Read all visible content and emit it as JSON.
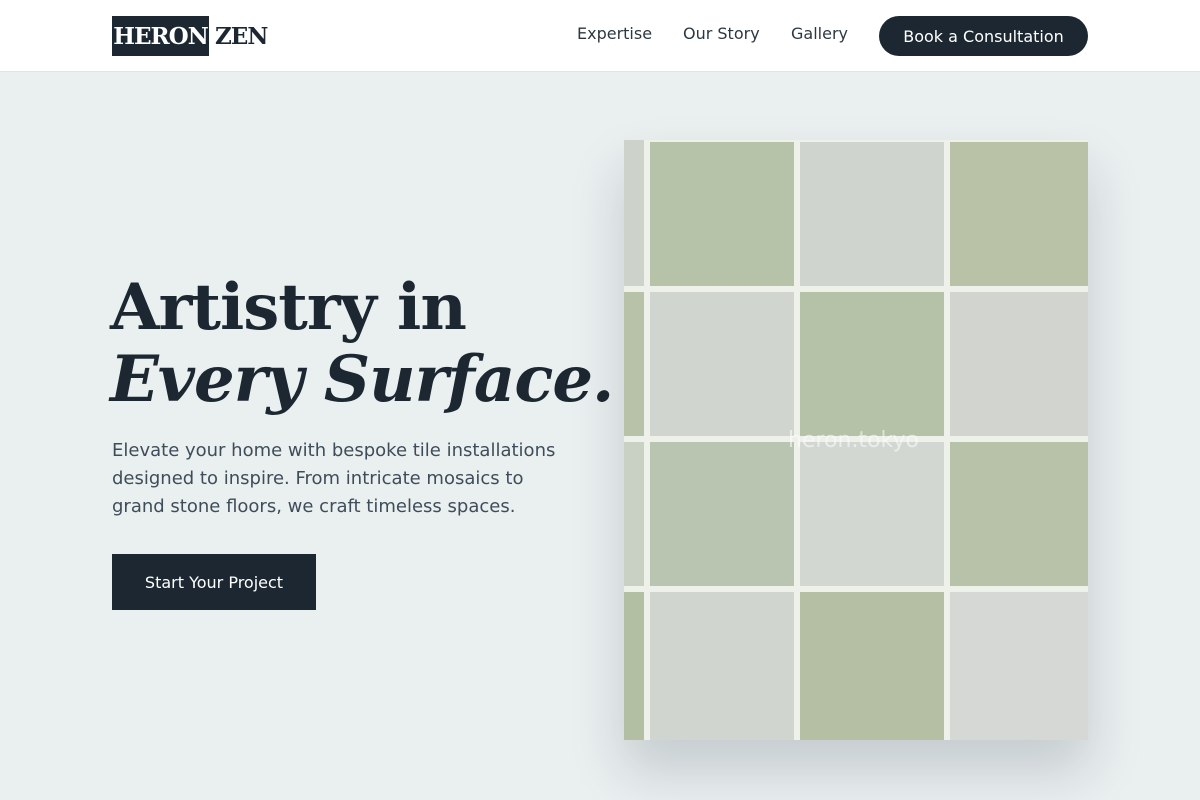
{
  "header": {
    "logo_primary": "HERON",
    "logo_secondary": "ZEN",
    "nav": [
      "Expertise",
      "Our Story",
      "Gallery"
    ],
    "cta_label": "Book a Consultation"
  },
  "hero": {
    "title_line1": "Artistry in",
    "title_line2": "Every Surface.",
    "description": "Elevate your home with bespoke tile installations designed to inspire. From intricate mosaics to grand stone floors, we craft timeless spaces.",
    "button_label": "Start Your Project"
  },
  "image": {
    "watermark": "heron.tokyo",
    "description_icon": "tile-photo"
  },
  "colors": {
    "primary": "#1c2731",
    "background": "#eaeff0",
    "tile_green": "#b6c2a5",
    "tile_grey": "#cfd3ce"
  }
}
